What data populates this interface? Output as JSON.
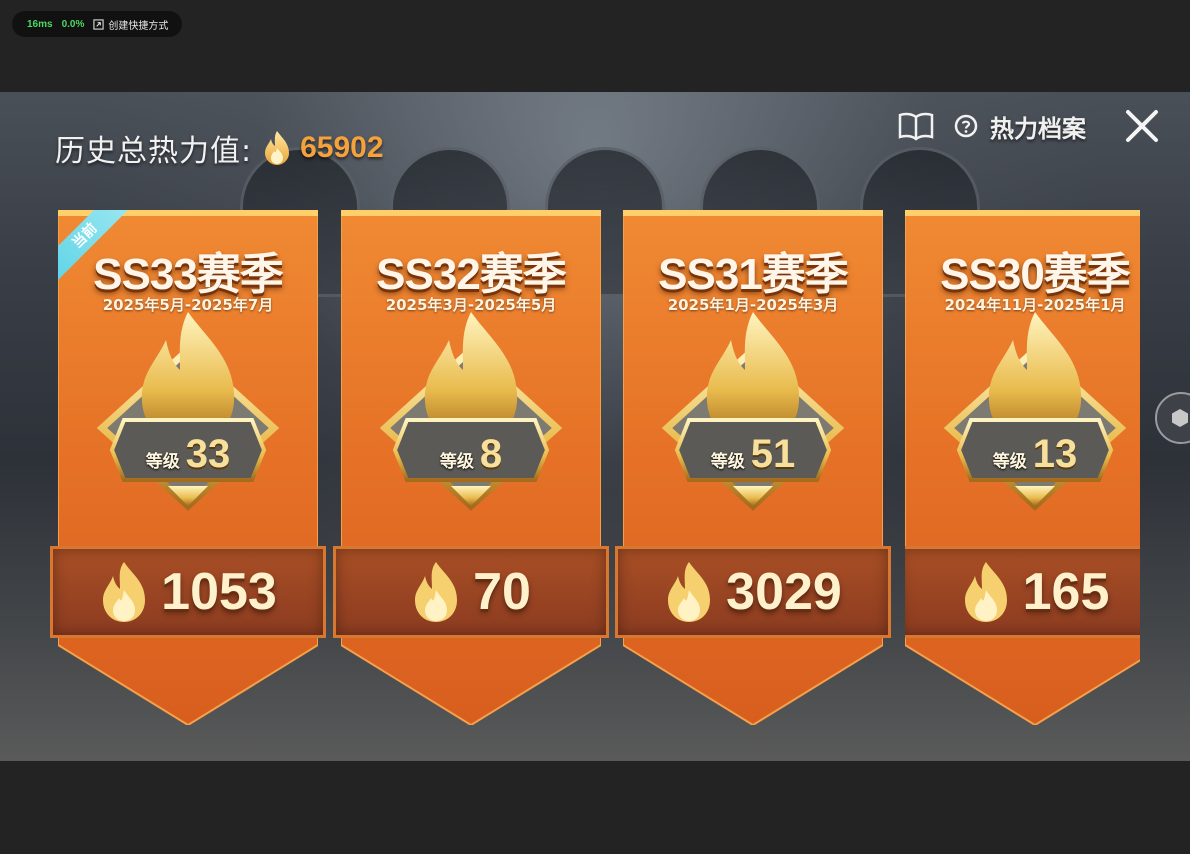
{
  "overlay": {
    "latency": "16ms",
    "loss": "0.0%",
    "shortcut_label": "创建快捷方式"
  },
  "header": {
    "title": "历史总热力值:",
    "total_heat": "65902",
    "archive_label": "热力档案"
  },
  "colors": {
    "card_orange": "#e8772c",
    "heat_gold": "#f5a23c",
    "current_tag": "#5fd4e8"
  },
  "cards": [
    {
      "season": "SS33赛季",
      "dates": "2025年5月-2025年7月",
      "level_label": "等级",
      "level": "33",
      "heat": "1053",
      "current_tag": "当前"
    },
    {
      "season": "SS32赛季",
      "dates": "2025年3月-2025年5月",
      "level_label": "等级",
      "level": "8",
      "heat": "70"
    },
    {
      "season": "SS31赛季",
      "dates": "2025年1月-2025年3月",
      "level_label": "等级",
      "level": "51",
      "heat": "3029"
    },
    {
      "season": "SS30赛季",
      "dates": "2024年11月-2025年1月",
      "level_label": "等级",
      "level": "13",
      "heat": "165"
    }
  ]
}
